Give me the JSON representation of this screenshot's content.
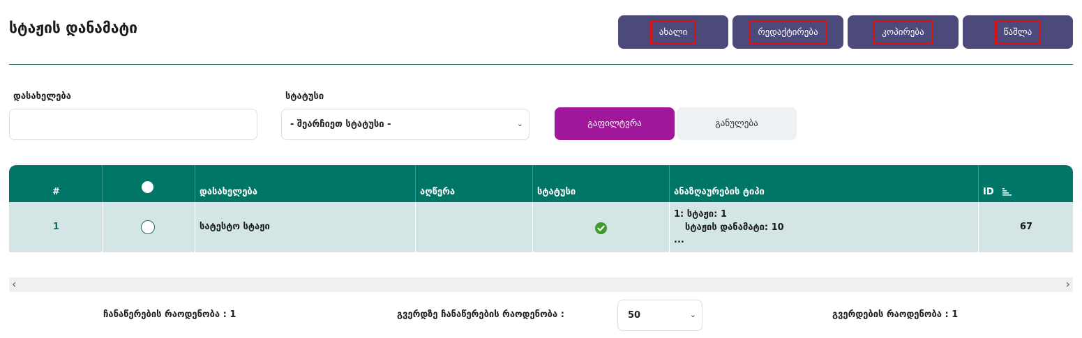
{
  "page": {
    "title": "სტაჟის დანამატი"
  },
  "toolbar": {
    "new_label": "ახალი",
    "edit_label": "რედაქტირება",
    "copy_label": "კოპირება",
    "delete_label": "წაშლა",
    "button_color": "#4c4a7a",
    "highlight_color": "#e01010"
  },
  "filters": {
    "name_label": "დასახელება",
    "name_value": "",
    "status_label": "სტატუსი",
    "status_selected": "- შეარჩიეთ სტატუსი -",
    "filter_button": "გაფილტვრა",
    "reset_button": "განულება",
    "filter_color": "#a0179b"
  },
  "table": {
    "header_color": "#007766",
    "row_color": "#d3e5e4",
    "columns": [
      "#",
      "",
      "დასახელება",
      "აღწერა",
      "სტატუსი",
      "ანაზღაურების ტიპი",
      "ID"
    ],
    "rows": [
      {
        "number": "1",
        "name": "სატესტო სტაჟი",
        "description": "",
        "status": "active",
        "payment_line1": "1: სტაჟი: 1",
        "payment_line2": "სტაჟის დანამატი: 10",
        "payment_line3": "...",
        "id": "67"
      }
    ]
  },
  "footer": {
    "records_count": "ჩანაწერების რაოდენობა : 1",
    "per_page_label": "გვერდზე ჩანაწერების რაოდენობა :",
    "per_page_value": "50",
    "pages_count": "გვერდების რაოდენობა : 1"
  }
}
